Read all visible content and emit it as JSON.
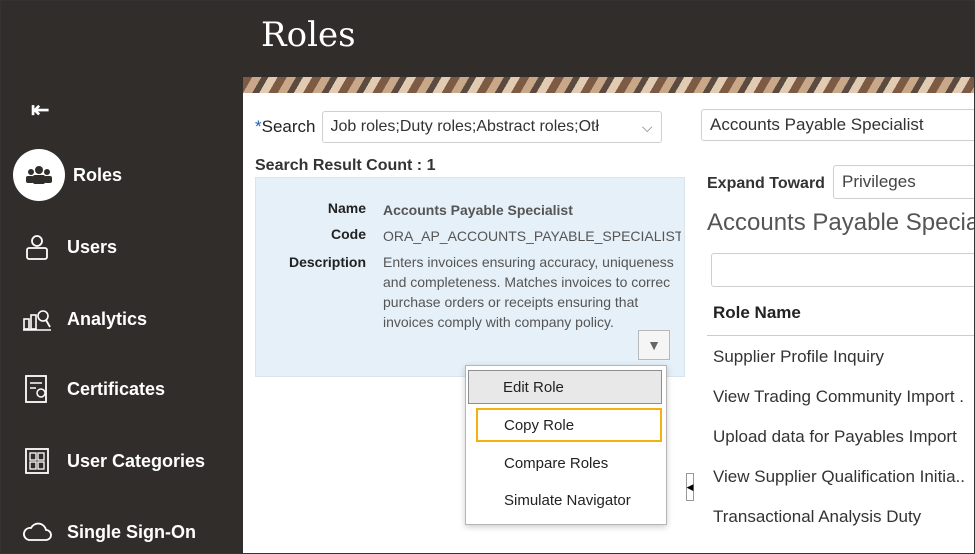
{
  "page": {
    "title": "Roles"
  },
  "sidebar": {
    "collapse_glyph": "⇤",
    "items": [
      {
        "label": "Roles",
        "icon": "users-group-icon",
        "active": true
      },
      {
        "label": "Users",
        "icon": "user-icon"
      },
      {
        "label": "Analytics",
        "icon": "analytics-icon"
      },
      {
        "label": "Certificates",
        "icon": "certificate-icon"
      },
      {
        "label": "User Categories",
        "icon": "categories-icon"
      },
      {
        "label": "Single Sign-On",
        "icon": "cloud-icon"
      }
    ]
  },
  "search": {
    "required_mark": "*",
    "label": "Search",
    "selected": "Job roles;Duty roles;Abstract roles;Otł"
  },
  "results": {
    "count_label": "Search Result Count : 1",
    "item": {
      "name_label": "Name",
      "name": "Accounts Payable Specialist",
      "code_label": "Code",
      "code": "ORA_AP_ACCOUNTS_PAYABLE_SPECIALIST_JC",
      "desc_label": "Description",
      "description": "Enters invoices ensuring accuracy, uniqueness and completeness. Matches invoices to correc purchase orders or receipts ensuring that invoices comply with company policy."
    }
  },
  "action_menu": {
    "items": [
      "Edit Role",
      "Copy Role",
      "Compare Roles",
      "Simulate Navigator"
    ]
  },
  "hierarchy": {
    "role_value": "Accounts Payable Specialist",
    "expand_label": "Expand Toward",
    "expand_value": "Privileges",
    "title": "Accounts Payable Speciali",
    "column_header": "Role Name",
    "rows": [
      "Supplier Profile Inquiry",
      "View Trading Community Import .",
      "Upload data for Payables Import",
      "View Supplier Qualification Initia..",
      "Transactional Analysis Duty"
    ]
  },
  "colors": {
    "sidebar_bg": "#312d2a",
    "card_bg": "#e6f0f8",
    "focus_ring": "#f2b20e"
  }
}
